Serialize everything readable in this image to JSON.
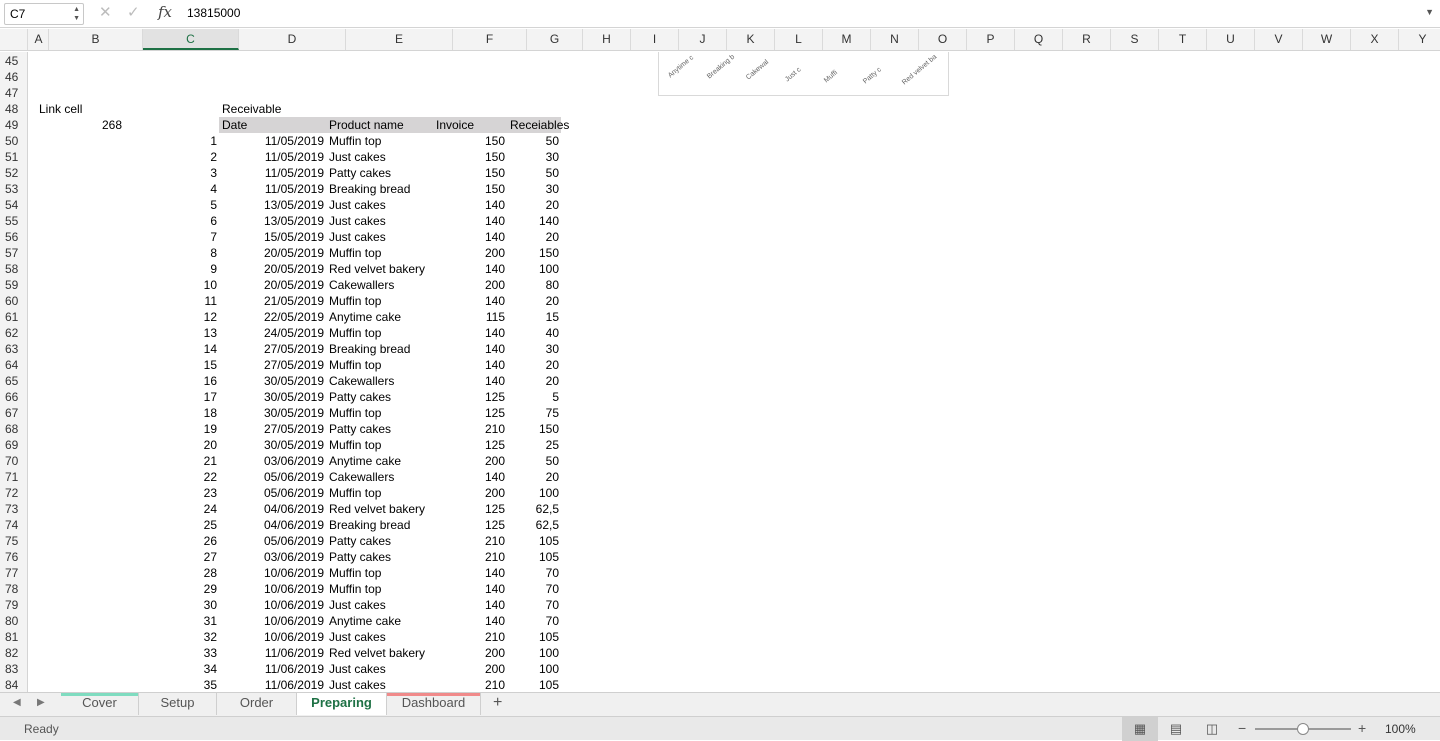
{
  "formula_bar": {
    "name_box": "C7",
    "cancel_icon": "✕",
    "enter_icon": "✓",
    "fx_label": "fx",
    "formula": "13815000"
  },
  "columns": [
    "A",
    "B",
    "C",
    "D",
    "E",
    "F",
    "G",
    "H",
    "I",
    "J",
    "K",
    "L",
    "M",
    "N",
    "O",
    "P",
    "Q",
    "R",
    "S",
    "T",
    "U",
    "V",
    "W",
    "X",
    "Y"
  ],
  "selected_column": "C",
  "rows": [
    "45",
    "46",
    "47",
    "48",
    "49",
    "50",
    "51",
    "52",
    "53",
    "54",
    "55",
    "56",
    "57",
    "58",
    "59",
    "60",
    "61",
    "62",
    "63",
    "64",
    "65",
    "66",
    "67",
    "68",
    "69",
    "70",
    "71",
    "72",
    "73",
    "74",
    "75",
    "76",
    "77",
    "78",
    "79",
    "80",
    "81",
    "82",
    "83",
    "84"
  ],
  "chart_fragment_labels": [
    "Anytime c",
    "Breaking b",
    "Cakewal",
    "Just c",
    "Muffi",
    "Patty c",
    "Red velvet ba"
  ],
  "sheet": {
    "link_cell_label": "Link cell",
    "link_cell_value": "268",
    "section_title": "Receivable",
    "table_headers": [
      "Date",
      "Product name",
      "Invoice",
      "Receiables"
    ],
    "records": [
      [
        "1",
        "11/05/2019",
        "Muffin top",
        "150",
        "50"
      ],
      [
        "2",
        "11/05/2019",
        "Just cakes",
        "150",
        "30"
      ],
      [
        "3",
        "11/05/2019",
        "Patty cakes",
        "150",
        "50"
      ],
      [
        "4",
        "11/05/2019",
        "Breaking bread",
        "150",
        "30"
      ],
      [
        "5",
        "13/05/2019",
        "Just cakes",
        "140",
        "20"
      ],
      [
        "6",
        "13/05/2019",
        "Just cakes",
        "140",
        "140"
      ],
      [
        "7",
        "15/05/2019",
        "Just cakes",
        "140",
        "20"
      ],
      [
        "8",
        "20/05/2019",
        "Muffin top",
        "200",
        "150"
      ],
      [
        "9",
        "20/05/2019",
        "Red velvet bakery",
        "140",
        "100"
      ],
      [
        "10",
        "20/05/2019",
        "Cakewallers",
        "200",
        "80"
      ],
      [
        "11",
        "21/05/2019",
        "Muffin top",
        "140",
        "20"
      ],
      [
        "12",
        "22/05/2019",
        "Anytime cake",
        "115",
        "15"
      ],
      [
        "13",
        "24/05/2019",
        "Muffin top",
        "140",
        "40"
      ],
      [
        "14",
        "27/05/2019",
        "Breaking bread",
        "140",
        "30"
      ],
      [
        "15",
        "27/05/2019",
        "Muffin top",
        "140",
        "20"
      ],
      [
        "16",
        "30/05/2019",
        "Cakewallers",
        "140",
        "20"
      ],
      [
        "17",
        "30/05/2019",
        "Patty cakes",
        "125",
        "5"
      ],
      [
        "18",
        "30/05/2019",
        "Muffin top",
        "125",
        "75"
      ],
      [
        "19",
        "27/05/2019",
        "Patty cakes",
        "210",
        "150"
      ],
      [
        "20",
        "30/05/2019",
        "Muffin top",
        "125",
        "25"
      ],
      [
        "21",
        "03/06/2019",
        "Anytime cake",
        "200",
        "50"
      ],
      [
        "22",
        "05/06/2019",
        "Cakewallers",
        "140",
        "20"
      ],
      [
        "23",
        "05/06/2019",
        "Muffin top",
        "200",
        "100"
      ],
      [
        "24",
        "04/06/2019",
        "Red velvet bakery",
        "125",
        "62,5"
      ],
      [
        "25",
        "04/06/2019",
        "Breaking bread",
        "125",
        "62,5"
      ],
      [
        "26",
        "05/06/2019",
        "Patty cakes",
        "210",
        "105"
      ],
      [
        "27",
        "03/06/2019",
        "Patty cakes",
        "210",
        "105"
      ],
      [
        "28",
        "10/06/2019",
        "Muffin top",
        "140",
        "70"
      ],
      [
        "29",
        "10/06/2019",
        "Muffin top",
        "140",
        "70"
      ],
      [
        "30",
        "10/06/2019",
        "Just cakes",
        "140",
        "70"
      ],
      [
        "31",
        "10/06/2019",
        "Anytime cake",
        "140",
        "70"
      ],
      [
        "32",
        "10/06/2019",
        "Just cakes",
        "210",
        "105"
      ],
      [
        "33",
        "11/06/2019",
        "Red velvet bakery",
        "200",
        "100"
      ],
      [
        "34",
        "11/06/2019",
        "Just cakes",
        "200",
        "100"
      ],
      [
        "35",
        "11/06/2019",
        "Just cakes",
        "210",
        "105"
      ]
    ]
  },
  "tabs": [
    {
      "label": "Cover",
      "color": "#7fdcc0",
      "active": false
    },
    {
      "label": "Setup",
      "color": "",
      "active": false
    },
    {
      "label": "Order",
      "color": "",
      "active": false
    },
    {
      "label": "Preparing",
      "color": "",
      "active": true
    },
    {
      "label": "Dashboard",
      "color": "#f08a8a",
      "active": false
    }
  ],
  "add_sheet_label": "+",
  "status": {
    "ready": "Ready",
    "zoom": "100%",
    "zoom_level": 1.0
  },
  "accent_color": "#1e7145"
}
